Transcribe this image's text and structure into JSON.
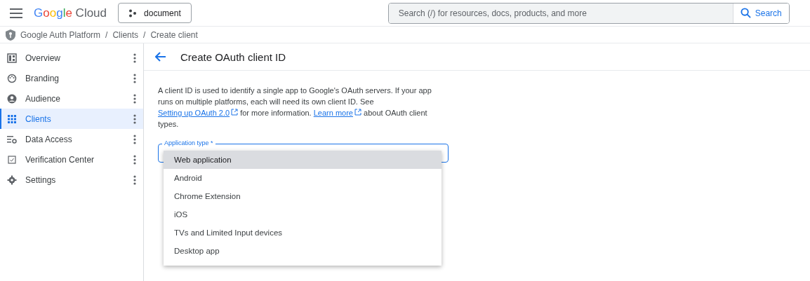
{
  "header": {
    "logo_brand": "Google",
    "logo_product": "Cloud",
    "project": "document",
    "search": {
      "placeholder": "Search (/) for resources, docs, products, and more",
      "button": "Search"
    }
  },
  "breadcrumb": [
    {
      "label": "Google Auth Platform"
    },
    {
      "separator": "/",
      "label": "Clients"
    },
    {
      "separator": "/",
      "label": "Create client"
    }
  ],
  "sidebar": {
    "items": [
      {
        "label": "Overview",
        "selected": false
      },
      {
        "label": "Branding",
        "selected": false
      },
      {
        "label": "Audience",
        "selected": false
      },
      {
        "label": "Clients",
        "selected": true
      },
      {
        "label": "Data Access",
        "selected": false
      },
      {
        "label": "Verification Center",
        "selected": false
      },
      {
        "label": "Settings",
        "selected": false
      }
    ]
  },
  "page": {
    "title": "Create OAuth client ID",
    "description": [
      {
        "kind": "text",
        "text": "A client ID is used to identify a single app to Google's OAuth servers. If your app runs on multiple platforms, each will need its own client ID. See "
      },
      {
        "kind": "link",
        "text": "Setting up OAuth 2.0"
      },
      {
        "kind": "text",
        "text": " for more information. "
      },
      {
        "kind": "link",
        "text": "Learn more"
      },
      {
        "kind": "text",
        "text": " about OAuth client types."
      }
    ],
    "field": {
      "label": "Application type *",
      "options": [
        {
          "label": "Web application",
          "selected": true
        },
        {
          "label": "Android",
          "selected": false
        },
        {
          "label": "Chrome Extension",
          "selected": false
        },
        {
          "label": "iOS",
          "selected": false
        },
        {
          "label": "TVs and Limited Input devices",
          "selected": false
        },
        {
          "label": "Desktop app",
          "selected": false
        }
      ]
    }
  }
}
